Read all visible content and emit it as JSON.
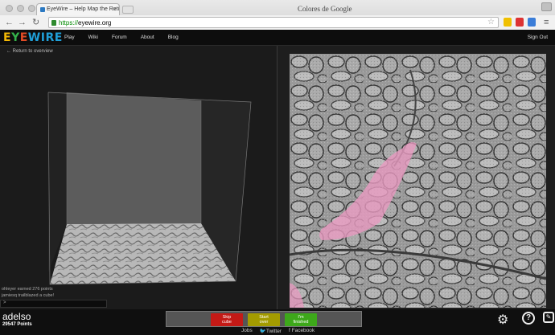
{
  "browser": {
    "tab_title": "EyeWire – Help Map the Reti",
    "window_title": "Colores de Google",
    "url_scheme": "https://",
    "url_host": "eyewire.org",
    "back_icon": "left-arrow-icon",
    "forward_icon": "right-arrow-icon",
    "reload_icon": "reload-icon"
  },
  "site_nav": {
    "logo": {
      "e1": "E",
      "y": "Y",
      "e2": "E",
      "w": "W",
      "i": "I",
      "r": "R",
      "e3": "E"
    },
    "links": [
      "Play",
      "Wiki",
      "Forum",
      "About",
      "Blog"
    ],
    "sign_out": "Sign Out"
  },
  "left_panel": {
    "back_link": "← Return to overview",
    "chat_lines": [
      "ohleyer earned 276 points",
      "jamiesq trailblazed a cube!"
    ],
    "chat_prompt": ">"
  },
  "bottom_bar": {
    "username": "adelso",
    "points": "29547 Points",
    "skip_l1": "Skip",
    "skip_l2": "cube",
    "start_l1": "Start",
    "start_l2": "over",
    "done_l1": "I'm",
    "done_l2": "finished",
    "footer_links": [
      "Jobs",
      "Twitter",
      "Facebook"
    ],
    "help_glyph": "?",
    "chat_glyph": "✎"
  },
  "colors": {
    "skip": "#c41a16",
    "start_over": "#a39b00",
    "finished": "#3da81a",
    "highlight_segment": "#e89ac0"
  }
}
